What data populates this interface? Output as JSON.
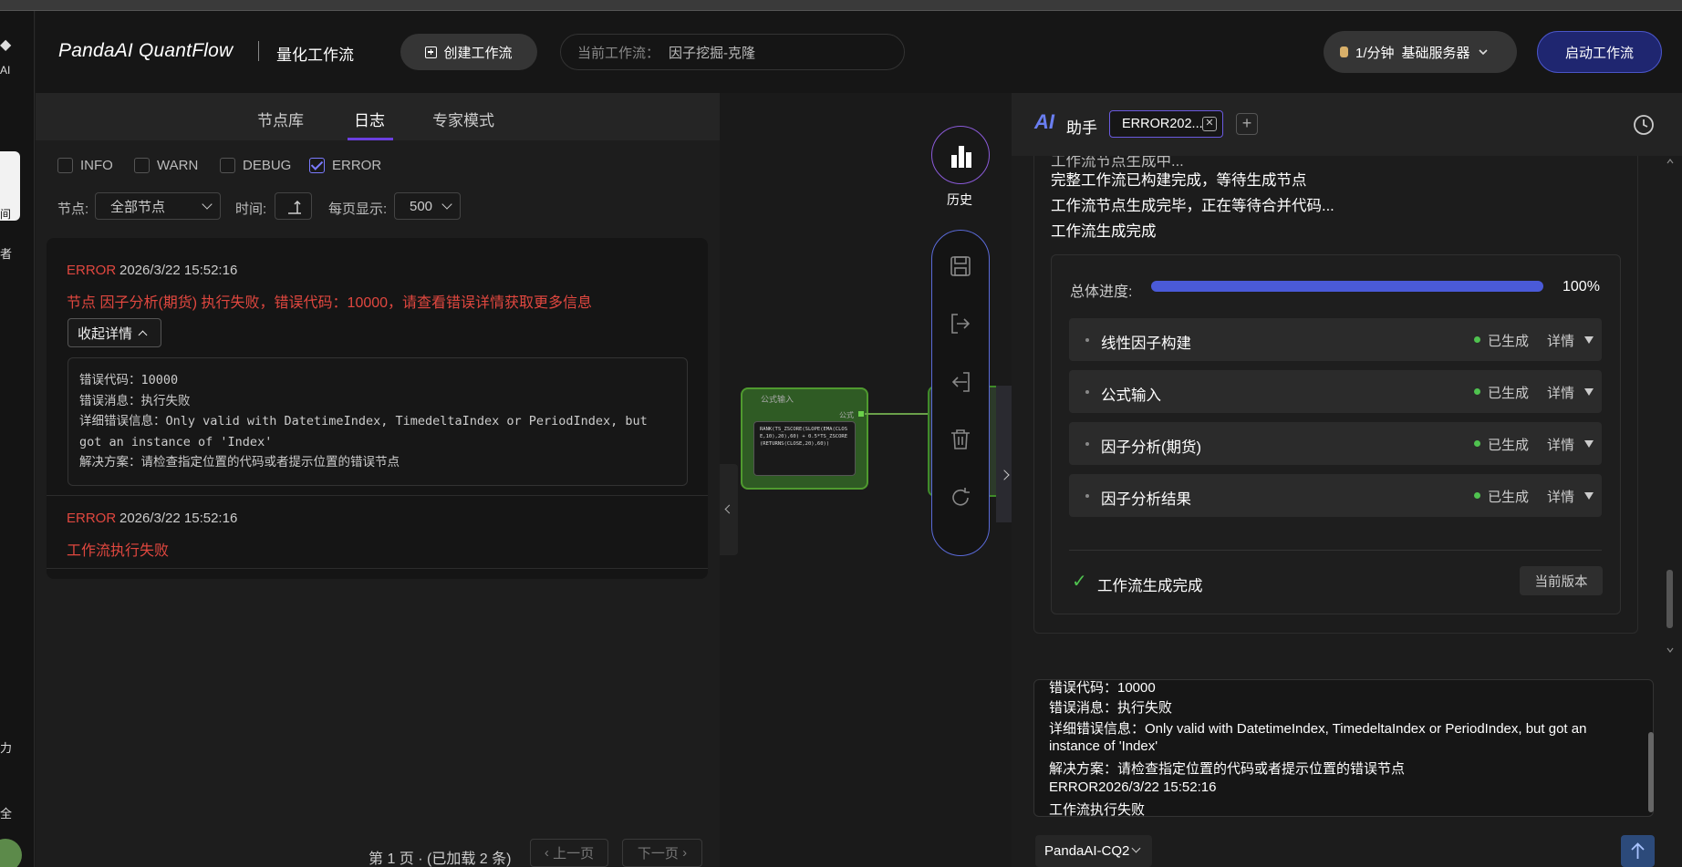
{
  "left_rail": {
    "logo_text": "AI",
    "active_item": "间",
    "item_1": "者",
    "item_2": "力",
    "item_3": "全"
  },
  "header": {
    "brand": "PandaAI QuantFlow",
    "app_title": "量化工作流",
    "create_label": "创建工作流",
    "current_label": "当前工作流：",
    "current_value": "因子挖掘-克隆",
    "server_rate": "1/分钟",
    "server_name": "基础服务器",
    "start_label": "启动工作流"
  },
  "tabs": {
    "t1": "节点库",
    "t2": "日志",
    "t3": "专家模式"
  },
  "filters": {
    "levels": [
      "INFO",
      "WARN",
      "DEBUG",
      "ERROR"
    ],
    "node_label": "节点:",
    "node_value": "全部节点",
    "time_label": "时间:",
    "per_page_label": "每页显示:",
    "per_page_value": "500"
  },
  "logs": [
    {
      "level": "ERROR",
      "time": "2026/3/22 15:52:16",
      "message": "节点 因子分析(期货) 执行失败，错误代码：10000，请查看错误详情获取更多信息",
      "collapse_label": "收起详情",
      "detail_1": "错误代码：10000",
      "detail_2": "错误消息：执行失败",
      "detail_3": "详细错误信息：Only valid with DatetimeIndex, TimedeltaIndex or PeriodIndex, but got an instance of 'Index'",
      "detail_4": "解决方案：请检查指定位置的代码或者提示位置的错误节点"
    },
    {
      "level": "ERROR",
      "time": "2026/3/22 15:52:16",
      "message": "工作流执行失败"
    }
  ],
  "pager": {
    "text": "第 1 页 · (已加载 2 条)",
    "prev": "上一页",
    "next": "下一页"
  },
  "canvas": {
    "node_title": "公式输入",
    "node_port_label": "公式",
    "node_code": "RANK(TS_ZSCORE(SLOPE(EMA(CLOSE,10),20),60) + 0.5*TS_ZSCORE(RETURNS(CLOSE,20),60))",
    "history_label": "历史"
  },
  "ai": {
    "logo": "AI",
    "title": "助手",
    "session_tab": "ERROR202...",
    "messages": [
      "工作流节点生成中...",
      "完整工作流已构建完成，等待生成节点",
      "工作流节点生成完毕，正在等待合并代码...",
      "工作流生成完成"
    ],
    "progress_label": "总体进度:",
    "progress_pct": "100%",
    "progress_value": 1.0,
    "steps": [
      {
        "name": "线性因子构建",
        "status": "已生成",
        "detail": "详情"
      },
      {
        "name": "公式输入",
        "status": "已生成",
        "detail": "详情"
      },
      {
        "name": "因子分析(期货)",
        "status": "已生成",
        "detail": "详情"
      },
      {
        "name": "因子分析结果",
        "status": "已生成",
        "detail": "详情"
      }
    ],
    "done_label": "工作流生成完成",
    "version_label": "当前版本",
    "input_lines": [
      "错误代码：10000",
      "错误消息：执行失败",
      "详细错误信息：Only valid with DatetimeIndex, TimedeltaIndex or PeriodIndex, but got an",
      "instance of 'Index'",
      "解决方案：请检查指定位置的代码或者提示位置的错误节点",
      "ERROR2026/3/22 15:52:16",
      "工作流执行失败"
    ],
    "model": "PandaAI-CQ2"
  },
  "colors": {
    "accent": "#6b3fe0",
    "error": "#e0473f",
    "success": "#4fc24f",
    "progress": "#4a5ad8"
  }
}
